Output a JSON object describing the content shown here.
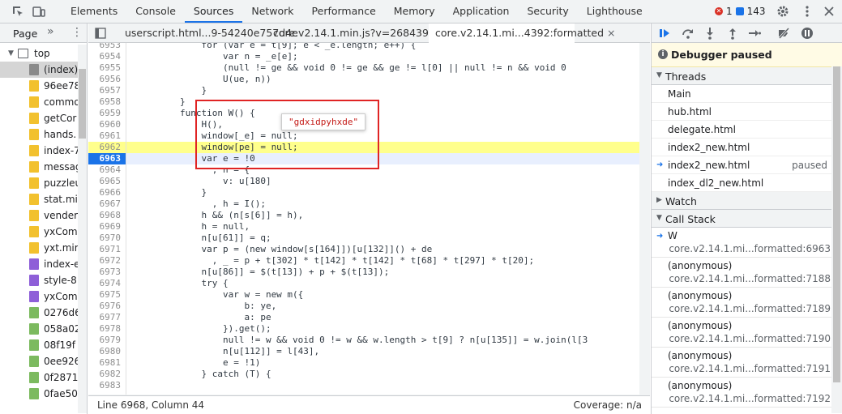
{
  "toolbar": {
    "tabs": [
      "Elements",
      "Console",
      "Sources",
      "Network",
      "Performance",
      "Memory",
      "Application",
      "Security",
      "Lighthouse"
    ],
    "active_tab": "Sources",
    "error_count": "1",
    "message_count": "143"
  },
  "navigator": {
    "tab": "Page",
    "top": "top",
    "items": [
      {
        "label": "(index)",
        "color": "#8a8a8a"
      },
      {
        "label": "96ee78",
        "color": "#f2c12e"
      },
      {
        "label": "commo",
        "color": "#f2c12e"
      },
      {
        "label": "getCor",
        "color": "#f2c12e"
      },
      {
        "label": "hands.",
        "color": "#f2c12e"
      },
      {
        "label": "index-7",
        "color": "#f2c12e"
      },
      {
        "label": "messag",
        "color": "#f2c12e"
      },
      {
        "label": "puzzleu",
        "color": "#f2c12e"
      },
      {
        "label": "stat.mi",
        "color": "#f2c12e"
      },
      {
        "label": "vender",
        "color": "#f2c12e"
      },
      {
        "label": "yxCom",
        "color": "#f2c12e"
      },
      {
        "label": "yxt.mir",
        "color": "#f2c12e"
      },
      {
        "label": "index-e",
        "color": "#8e5fd8"
      },
      {
        "label": "style-8",
        "color": "#8e5fd8"
      },
      {
        "label": "yxCom",
        "color": "#8e5fd8"
      },
      {
        "label": "0276d6",
        "color": "#7cba5f"
      },
      {
        "label": "058a02",
        "color": "#7cba5f"
      },
      {
        "label": "08f19f",
        "color": "#7cba5f"
      },
      {
        "label": "0ee926",
        "color": "#7cba5f"
      },
      {
        "label": "0f2871",
        "color": "#7cba5f"
      },
      {
        "label": "0fae50",
        "color": "#7cba5f"
      }
    ]
  },
  "editor": {
    "tabs": [
      "userscript.html...9-54240e757d4e",
      "core.v2.14.1.min.js?v=2684392",
      "core.v2.14.1.mi...4392:formatted"
    ],
    "active_tab": 2,
    "lines": [
      {
        "n": "6953",
        "t": "            for (var e = t[9]; e < _e.length; e++) {"
      },
      {
        "n": "6954",
        "t": "                var n = _e[e];"
      },
      {
        "n": "6955",
        "t": "                (null != ge && void 0 != ge && ge != l[0] || null != n && void 0"
      },
      {
        "n": "6956",
        "t": "                U(ue, n))"
      },
      {
        "n": "6957",
        "t": "            }"
      },
      {
        "n": "6958",
        "t": "        }"
      },
      {
        "n": "6959",
        "t": "        function W() {"
      },
      {
        "n": "6960",
        "t": "            H(),"
      },
      {
        "n": "6961",
        "t": "            window[_e] = null;"
      },
      {
        "n": "6962",
        "t": "            window[pe] = null;"
      },
      {
        "n": "6963",
        "t": "            var e = !0"
      },
      {
        "n": "6964",
        "t": "              , n = {"
      },
      {
        "n": "6965",
        "t": "                v: u[180]"
      },
      {
        "n": "6966",
        "t": "            }"
      },
      {
        "n": "6967",
        "t": "              , h = I();"
      },
      {
        "n": "6968",
        "t": "            h && (n[s[6]] = h),"
      },
      {
        "n": "6969",
        "t": "            h = null,"
      },
      {
        "n": "6970",
        "t": "            n[u[61]] = q;"
      },
      {
        "n": "6971",
        "t": "            var p = (new window[s[164]])[u[132]]() + de"
      },
      {
        "n": "6972",
        "t": "              , _ = p + t[302] * t[142] * t[142] * t[68] * t[297] * t[20];"
      },
      {
        "n": "6973",
        "t": "            n[u[86]] = $(t[13]) + p + $(t[13]);"
      },
      {
        "n": "6974",
        "t": "            try {"
      },
      {
        "n": "6975",
        "t": "                var w = new m({"
      },
      {
        "n": "6976",
        "t": "                    b: ye,"
      },
      {
        "n": "6977",
        "t": "                    a: pe"
      },
      {
        "n": "6978",
        "t": "                }).get();"
      },
      {
        "n": "6979",
        "t": "                null != w && void 0 != w && w.length > t[9] ? n[u[135]] = w.join(l[3"
      },
      {
        "n": "6980",
        "t": "                n[u[112]] = l[43],"
      },
      {
        "n": "6981",
        "t": "                e = !1)"
      },
      {
        "n": "6982",
        "t": "            } catch (T) {"
      },
      {
        "n": "6983",
        "t": ""
      }
    ],
    "tooltip": "\"gdxidpyhxde\"",
    "status_position": "Line 6968, Column 44",
    "status_coverage": "Coverage: n/a"
  },
  "debugger": {
    "paused_text": "Debugger paused",
    "threads_title": "Threads",
    "threads": [
      {
        "name": "Main",
        "status": ""
      },
      {
        "name": "hub.html",
        "status": ""
      },
      {
        "name": "delegate.html",
        "status": ""
      },
      {
        "name": "index2_new.html",
        "status": ""
      },
      {
        "name": "index2_new.html",
        "status": "paused"
      },
      {
        "name": "index_dl2_new.html",
        "status": ""
      }
    ],
    "watch_title": "Watch",
    "callstack_title": "Call Stack",
    "callstack": [
      {
        "fn": "W",
        "loc": "core.v2.14.1.mi...formatted:6963"
      },
      {
        "fn": "(anonymous)",
        "loc": "core.v2.14.1.mi...formatted:7188"
      },
      {
        "fn": "(anonymous)",
        "loc": "core.v2.14.1.mi...formatted:7189"
      },
      {
        "fn": "(anonymous)",
        "loc": "core.v2.14.1.mi...formatted:7190"
      },
      {
        "fn": "(anonymous)",
        "loc": "core.v2.14.1.mi...formatted:7191"
      },
      {
        "fn": "(anonymous)",
        "loc": "core.v2.14.1.mi...formatted:7192"
      }
    ]
  }
}
